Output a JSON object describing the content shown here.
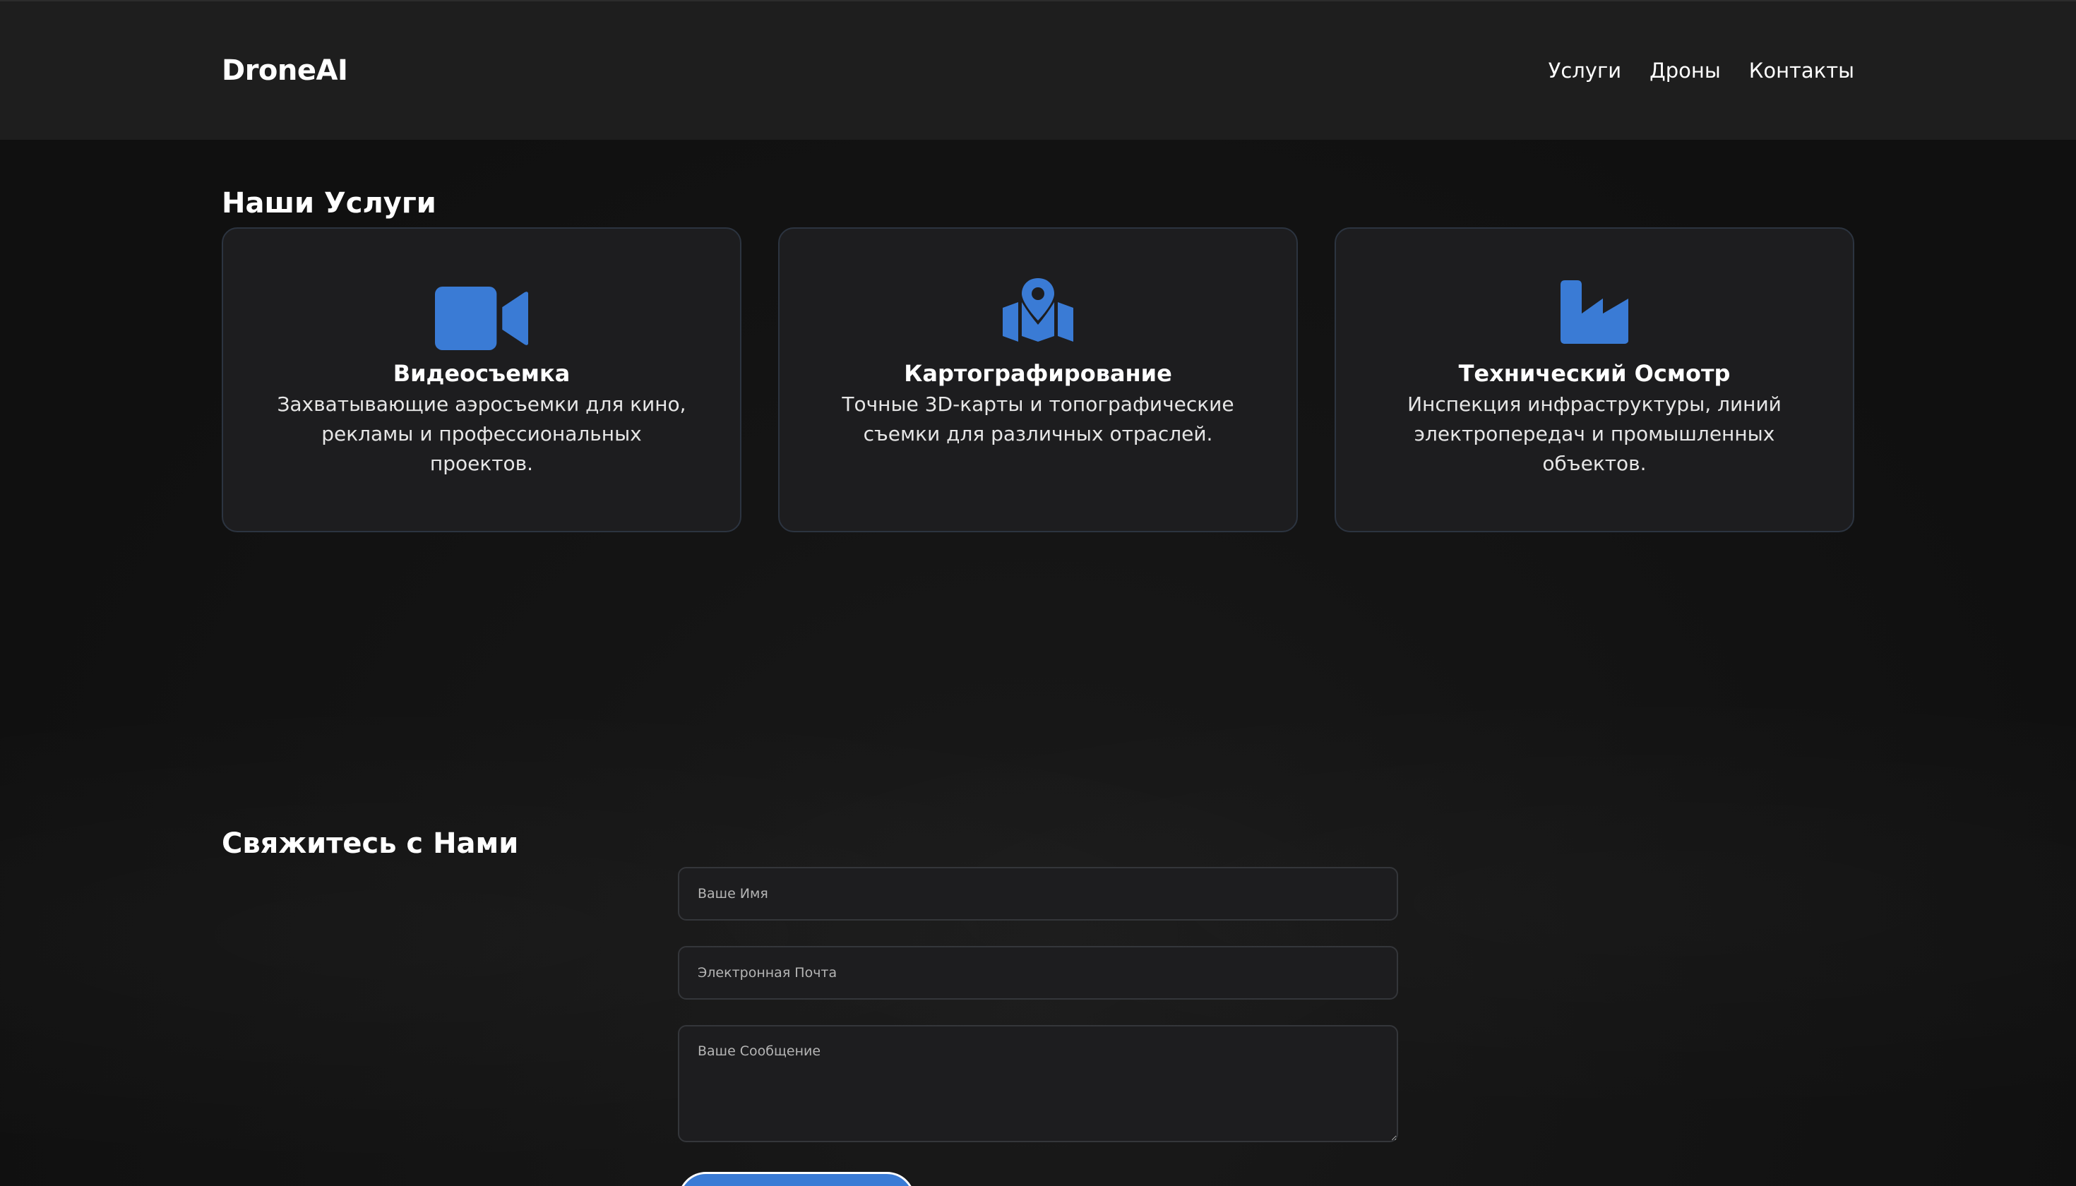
{
  "header": {
    "brand": "DroneAI",
    "nav": [
      "Услуги",
      "Дроны",
      "Контакты"
    ]
  },
  "services": {
    "title": "Наши Услуги",
    "accent_color": "#3a7bd5",
    "cards": [
      {
        "icon": "video-camera-icon",
        "title": "Видеосъемка",
        "text": "Захватывающие аэросъемки для кино, рекламы и профессиональных проектов."
      },
      {
        "icon": "map-location-icon",
        "title": "Картографирование",
        "text": "Точные 3D-карты и топографические съемки для различных отраслей."
      },
      {
        "icon": "industry-icon",
        "title": "Технический Осмотр",
        "text": "Инспекция инфраструктуры, линий электропередач и промышленных объектов."
      }
    ]
  },
  "contact": {
    "title": "Свяжитесь с Нами",
    "name_placeholder": "Ваше Имя",
    "email_placeholder": "Электронная Почта",
    "message_placeholder": "Ваше Сообщение"
  }
}
